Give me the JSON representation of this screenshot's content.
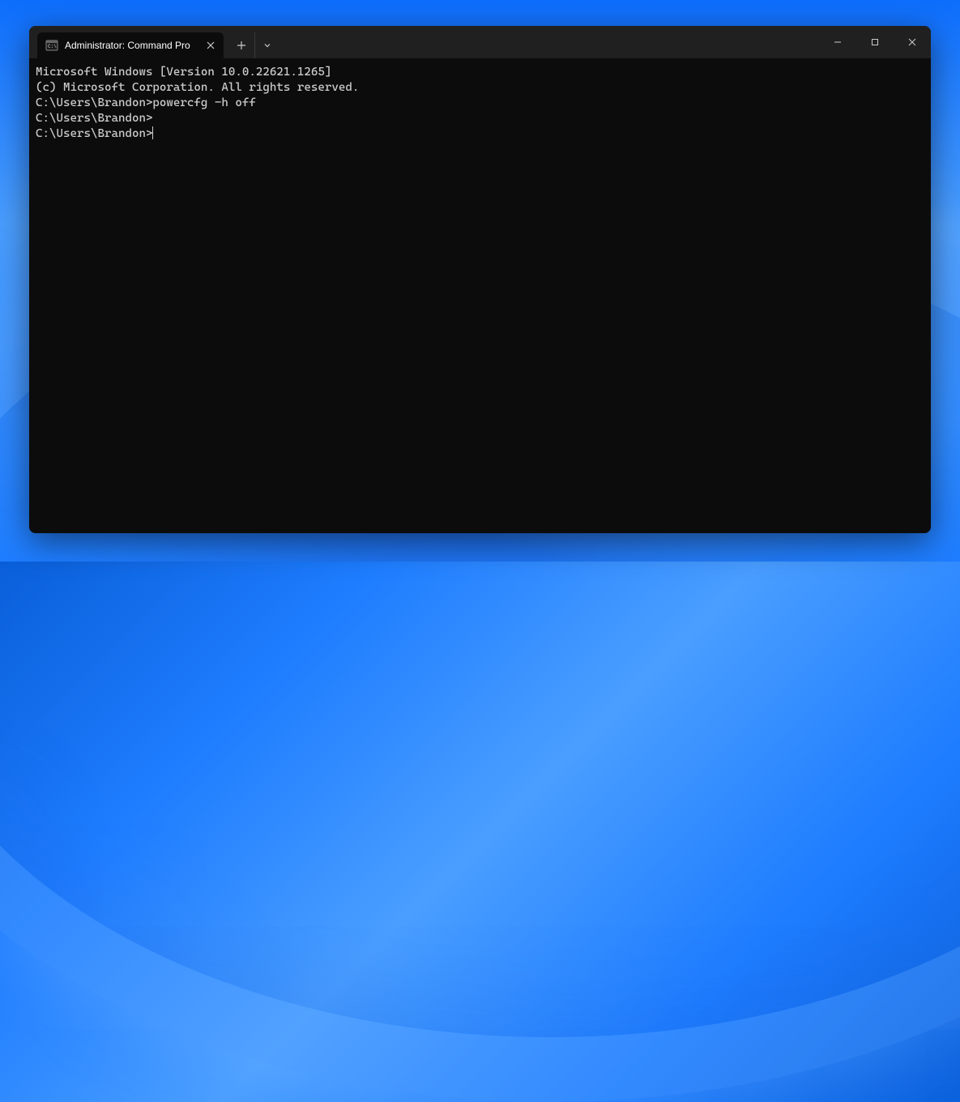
{
  "titlebar": {
    "tab": {
      "title": "Administrator: Command Pro"
    }
  },
  "terminal": {
    "lines": [
      "Microsoft Windows [Version 10.0.22621.1265]",
      "(c) Microsoft Corporation. All rights reserved.",
      "",
      "C:\\Users\\Brandon>powercfg -h off",
      "",
      "C:\\Users\\Brandon>",
      "C:\\Users\\Brandon>"
    ]
  }
}
